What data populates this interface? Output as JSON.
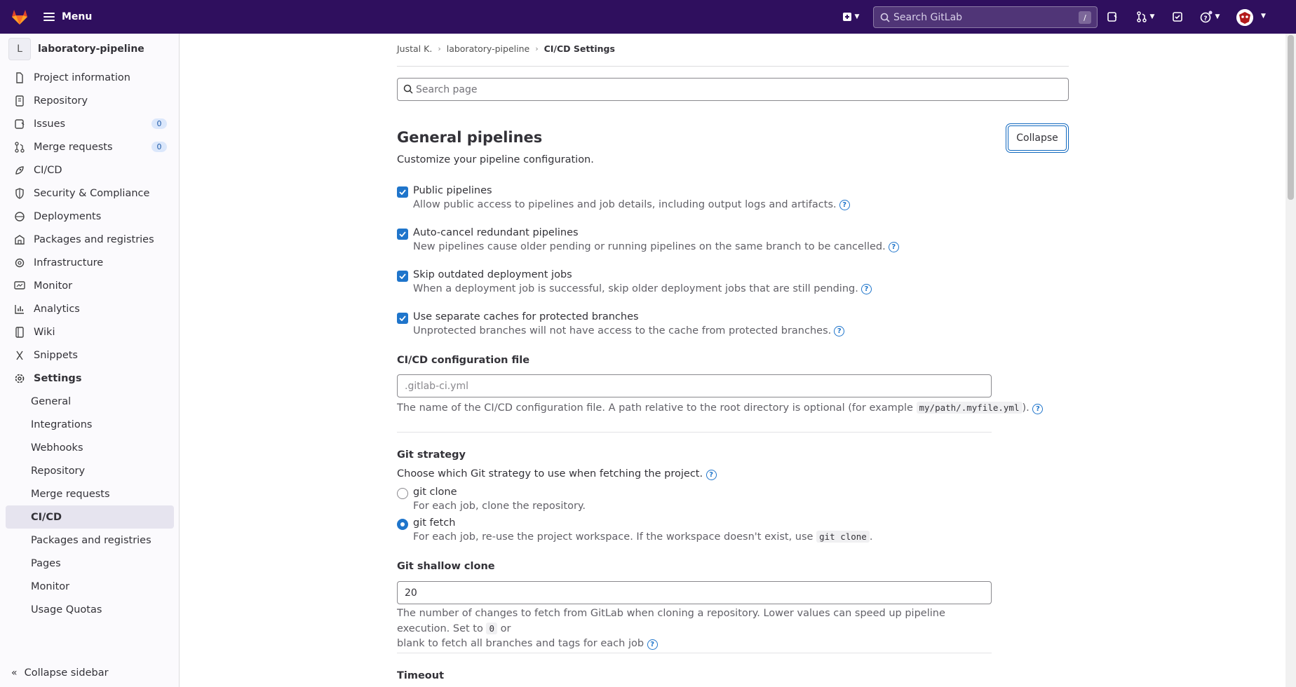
{
  "topbar": {
    "menu_label": "Menu",
    "search_placeholder": "Search GitLab",
    "search_shortcut": "/",
    "brand_color": "#2f0f5e"
  },
  "sidebar": {
    "project_initial": "L",
    "project_name": "laboratory-pipeline",
    "items": [
      {
        "label": "Project information",
        "icon": "info-icon"
      },
      {
        "label": "Repository",
        "icon": "document-icon"
      },
      {
        "label": "Issues",
        "icon": "issues-icon",
        "badge": "0"
      },
      {
        "label": "Merge requests",
        "icon": "merge-request-icon",
        "badge": "0"
      },
      {
        "label": "CI/CD",
        "icon": "rocket-icon"
      },
      {
        "label": "Security & Compliance",
        "icon": "shield-icon"
      },
      {
        "label": "Deployments",
        "icon": "deployments-icon"
      },
      {
        "label": "Packages and registries",
        "icon": "package-icon"
      },
      {
        "label": "Infrastructure",
        "icon": "cloud-gear-icon"
      },
      {
        "label": "Monitor",
        "icon": "monitor-icon"
      },
      {
        "label": "Analytics",
        "icon": "chart-icon"
      },
      {
        "label": "Wiki",
        "icon": "book-icon"
      },
      {
        "label": "Snippets",
        "icon": "scissors-icon"
      },
      {
        "label": "Settings",
        "icon": "settings-icon"
      }
    ],
    "settings_sub": [
      {
        "label": "General"
      },
      {
        "label": "Integrations"
      },
      {
        "label": "Webhooks"
      },
      {
        "label": "Repository"
      },
      {
        "label": "Merge requests"
      },
      {
        "label": "CI/CD",
        "active": true
      },
      {
        "label": "Packages and registries"
      },
      {
        "label": "Pages"
      },
      {
        "label": "Monitor"
      },
      {
        "label": "Usage Quotas"
      }
    ],
    "collapse_label": "Collapse sidebar"
  },
  "breadcrumb": {
    "user": "Justal K.",
    "project": "laboratory-pipeline",
    "current": "CI/CD Settings"
  },
  "page_search_placeholder": "Search page",
  "section": {
    "title": "General pipelines",
    "collapse_label": "Collapse",
    "description": "Customize your pipeline configuration."
  },
  "checkboxes": [
    {
      "label": "Public pipelines",
      "help": "Allow public access to pipelines and job details, including output logs and artifacts.",
      "checked": true
    },
    {
      "label": "Auto-cancel redundant pipelines",
      "help": "New pipelines cause older pending or running pipelines on the same branch to be cancelled.",
      "checked": true
    },
    {
      "label": "Skip outdated deployment jobs",
      "help": "When a deployment job is successful, skip older deployment jobs that are still pending.",
      "checked": true
    },
    {
      "label": "Use separate caches for protected branches",
      "help": "Unprotected branches will not have access to the cache from protected branches.",
      "checked": true
    }
  ],
  "config_file": {
    "label": "CI/CD configuration file",
    "placeholder": ".gitlab-ci.yml",
    "help_before": "The name of the CI/CD configuration file. A path relative to the root directory is optional (for example",
    "help_code": "my/path/.myfile.yml",
    "help_after": ")."
  },
  "git_strategy": {
    "label": "Git strategy",
    "description": "Choose which Git strategy to use when fetching the project.",
    "options": [
      {
        "label": "git clone",
        "help": "For each job, clone the repository.",
        "selected": false
      },
      {
        "label": "git fetch",
        "help_before": "For each job, re-use the project workspace. If the workspace doesn't exist, use",
        "help_code": "git clone",
        "help_after": ".",
        "selected": true
      }
    ]
  },
  "shallow_clone": {
    "label": "Git shallow clone",
    "value": "20",
    "help_line1_before": "The number of changes to fetch from GitLab when cloning a repository. Lower values can speed up pipeline execution. Set to",
    "help_line1_code": "0",
    "help_line1_after": "or",
    "help_line2": "blank to fetch all branches and tags for each job"
  },
  "timeout": {
    "label": "Timeout"
  }
}
